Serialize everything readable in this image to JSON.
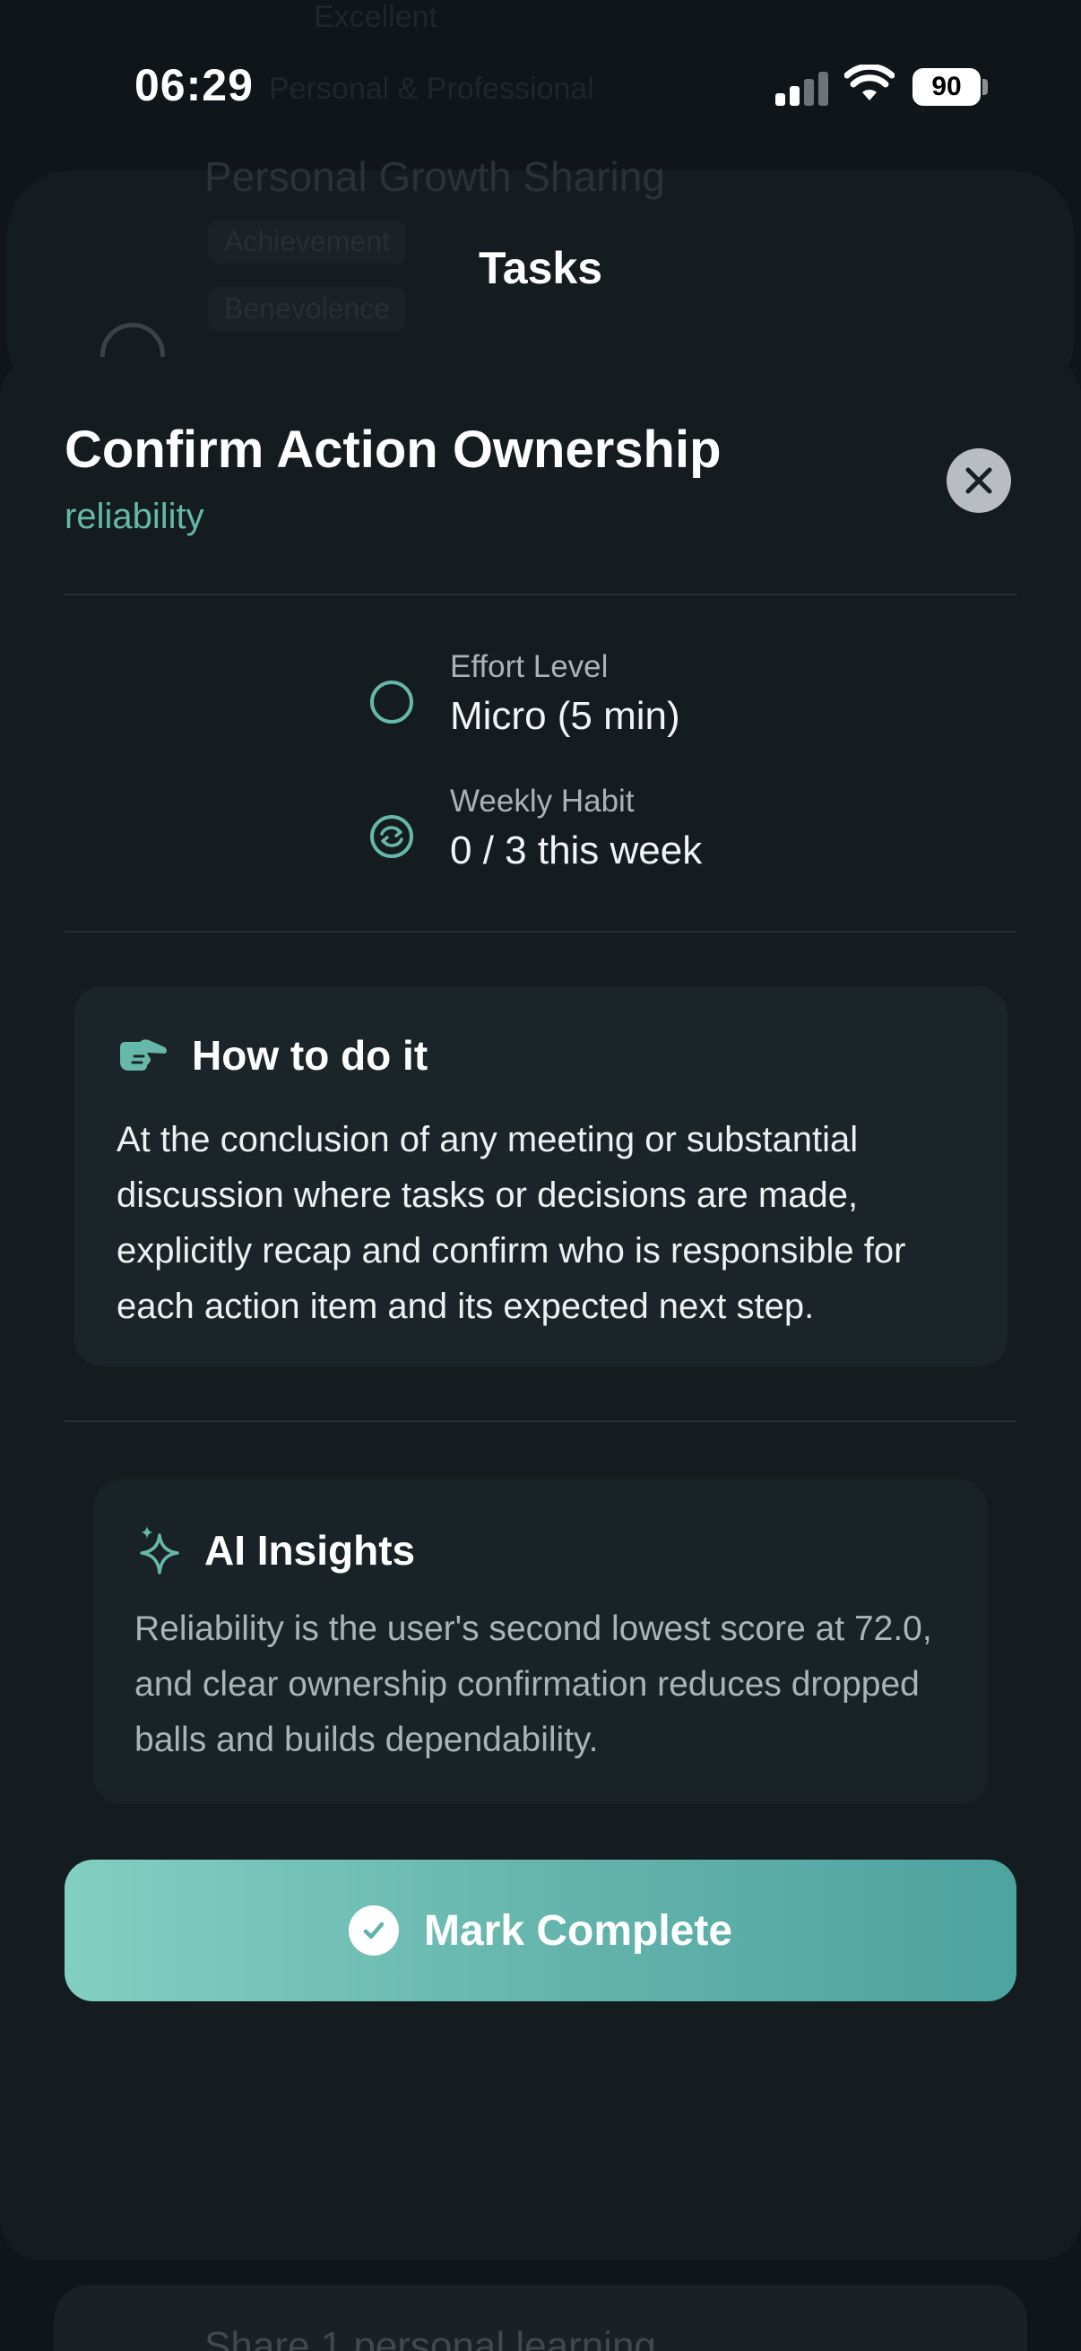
{
  "status_bar": {
    "time": "06:29",
    "battery": "90"
  },
  "background": {
    "line_top": "Excellent",
    "line_second": "Personal & Professional",
    "card_title": "Personal Growth Sharing",
    "chip_1": "Achievement",
    "chip_2": "Benevolence",
    "bottom_card": "Share 1 personal learning"
  },
  "header": {
    "title": "Tasks"
  },
  "task": {
    "title": "Confirm Action Ownership",
    "category": "reliability",
    "effort_label": "Effort Level",
    "effort_value": "Micro (5 min)",
    "habit_label": "Weekly Habit",
    "habit_value": "0 / 3 this week",
    "howto_title": "How to do it",
    "howto_body": "At the conclusion of any meeting or substantial discussion where tasks or decisions are made, explicitly recap and confirm who is responsible for each action item and its expected next step.",
    "ai_title": "AI Insights",
    "ai_body": "Reliability is the user's second lowest score at 72.0, and clear ownership confirmation reduces dropped balls and builds dependability.",
    "complete_label": "Mark Complete"
  },
  "colors": {
    "accent": "#66b8aa",
    "sheet": "#141c20",
    "button_gradient_start": "#82cfc1",
    "button_gradient_end": "#4da3a0"
  },
  "icons": {
    "close": "close-icon",
    "effort": "circle-outline-icon",
    "habit": "repeat-icon",
    "howto": "pointing-hand-icon",
    "ai": "sparkles-icon",
    "complete": "checkmark-icon"
  }
}
